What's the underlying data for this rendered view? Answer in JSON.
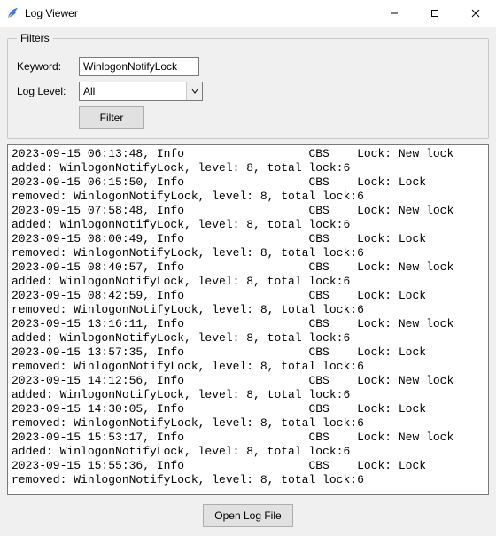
{
  "window": {
    "title": "Log Viewer"
  },
  "filters": {
    "legend": "Filters",
    "keyword_label": "Keyword:",
    "keyword_value": "WinlogonNotifyLock",
    "loglevel_label": "Log Level:",
    "loglevel_value": "All",
    "filter_button": "Filter"
  },
  "log": {
    "entries": [
      "2023-09-15 06:13:48, Info                  CBS    Lock: New lock added: WinlogonNotifyLock, level: 8, total lock:6",
      "2023-09-15 06:15:50, Info                  CBS    Lock: Lock removed: WinlogonNotifyLock, level: 8, total lock:6",
      "2023-09-15 07:58:48, Info                  CBS    Lock: New lock added: WinlogonNotifyLock, level: 8, total lock:6",
      "2023-09-15 08:00:49, Info                  CBS    Lock: Lock removed: WinlogonNotifyLock, level: 8, total lock:6",
      "2023-09-15 08:40:57, Info                  CBS    Lock: New lock added: WinlogonNotifyLock, level: 8, total lock:6",
      "2023-09-15 08:42:59, Info                  CBS    Lock: Lock removed: WinlogonNotifyLock, level: 8, total lock:6",
      "2023-09-15 13:16:11, Info                  CBS    Lock: New lock added: WinlogonNotifyLock, level: 8, total lock:6",
      "2023-09-15 13:57:35, Info                  CBS    Lock: Lock removed: WinlogonNotifyLock, level: 8, total lock:6",
      "2023-09-15 14:12:56, Info                  CBS    Lock: New lock added: WinlogonNotifyLock, level: 8, total lock:6",
      "2023-09-15 14:30:05, Info                  CBS    Lock: Lock removed: WinlogonNotifyLock, level: 8, total lock:6",
      "2023-09-15 15:53:17, Info                  CBS    Lock: New lock added: WinlogonNotifyLock, level: 8, total lock:6",
      "2023-09-15 15:55:36, Info                  CBS    Lock: Lock removed: WinlogonNotifyLock, level: 8, total lock:6"
    ]
  },
  "bottom": {
    "open_button": "Open Log File"
  }
}
